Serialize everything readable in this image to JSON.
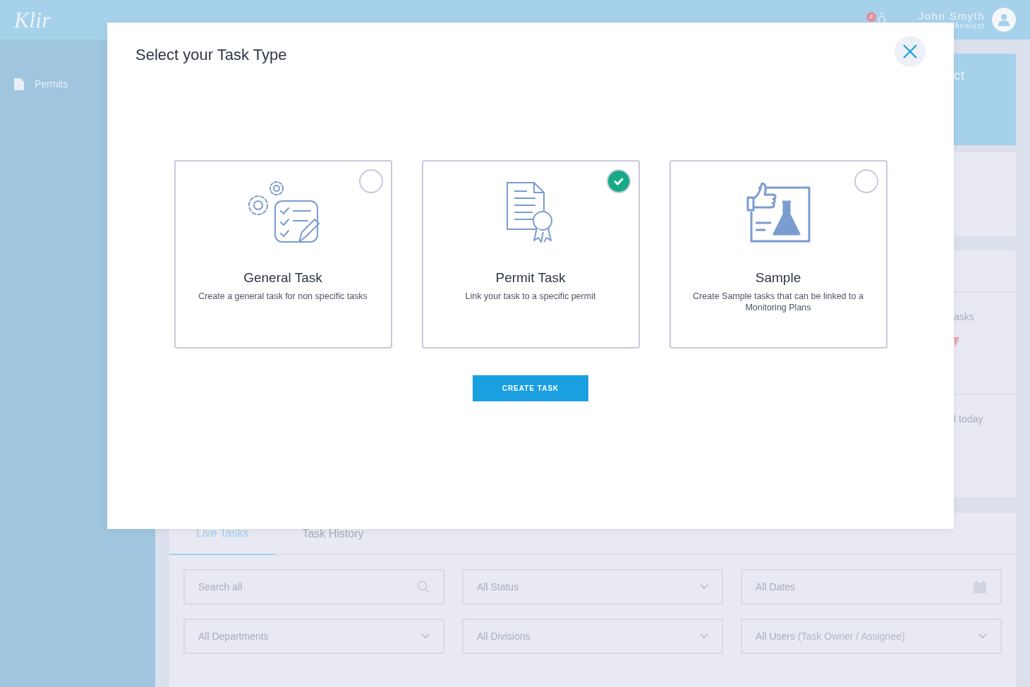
{
  "header": {
    "logo": "Klir",
    "notification_count": "2",
    "user": {
      "name": "John Smyth",
      "role": "Analyst"
    }
  },
  "sidebar": {
    "items": [
      {
        "label": "Permits",
        "selected": false
      }
    ]
  },
  "background_cards": {
    "banner_text": "ct",
    "row_texts": [
      "asks",
      "l today"
    ]
  },
  "tasks_panel": {
    "tabs": [
      {
        "label": "Live Tasks",
        "selected": true
      },
      {
        "label": "Task History",
        "selected": false
      }
    ],
    "filters": [
      {
        "kind": "search",
        "placeholder": "Search all"
      },
      {
        "kind": "select",
        "value": "All Status"
      },
      {
        "kind": "date",
        "value": "All Dates"
      },
      {
        "kind": "select",
        "value": "All Departments"
      },
      {
        "kind": "select",
        "value": "All Divisions"
      },
      {
        "kind": "select",
        "value": "All Users",
        "hint": "(Task Owner / Assignee)"
      }
    ]
  },
  "modal": {
    "title": "Select your Task Type",
    "options": [
      {
        "kind": "general",
        "title": "General Task",
        "description": "Create a general task for non specific tasks",
        "selected": false
      },
      {
        "kind": "permit",
        "title": "Permit Task",
        "description": "Link your task to a specific permit",
        "selected": true
      },
      {
        "kind": "sample",
        "title": "Sample",
        "description": "Create Sample tasks that can be linked to a Monitoring Plans",
        "selected": false
      }
    ],
    "button": "CREATE TASK"
  }
}
